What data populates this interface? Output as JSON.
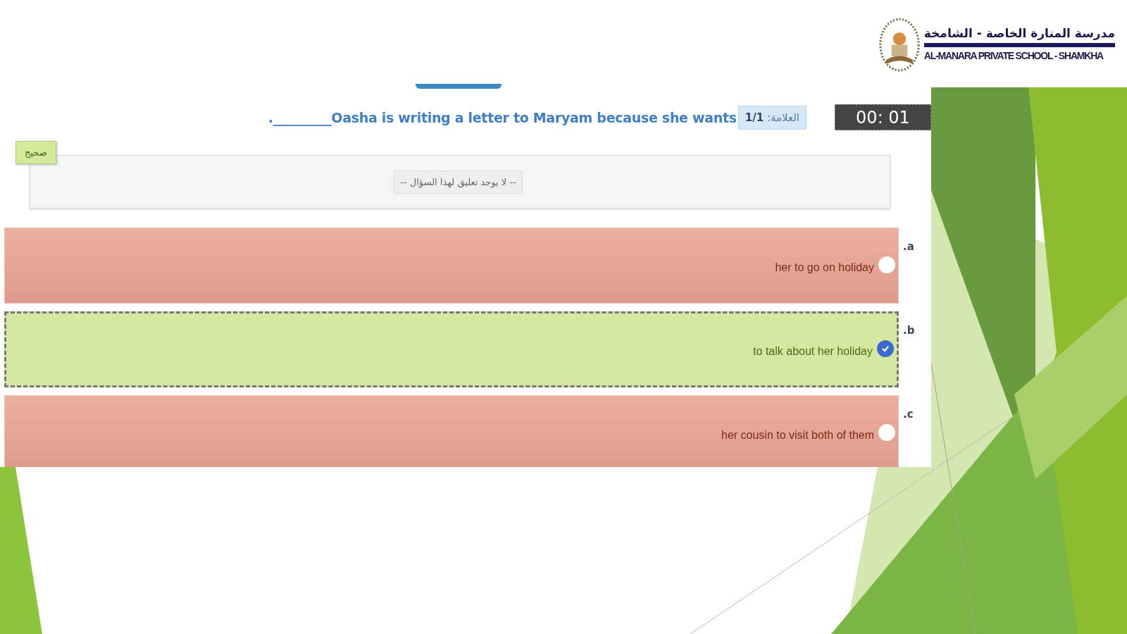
{
  "header": {
    "school_name_arabic": "مدرسة المنارة الخاصة - الشامخة",
    "school_name_english": "AL-MANARA PRIVATE SCHOOL - SHAMKHA"
  },
  "timer": "00: 01",
  "mark": {
    "label": "العلامة:",
    "value": "1/1"
  },
  "question": "._________Oasha is writing a letter to Maryam because she wants",
  "result": "صحيح",
  "comment": "-- لا يوجد تعليق لهذا السؤال --",
  "options": [
    {
      "letter": ".a",
      "text": "her to go on holiday",
      "selected": false,
      "correct": false
    },
    {
      "letter": ".b",
      "text": "to talk about her holiday",
      "selected": true,
      "correct": true
    },
    {
      "letter": ".c",
      "text": "her cousin to visit both of them",
      "selected": false,
      "correct": false
    }
  ]
}
